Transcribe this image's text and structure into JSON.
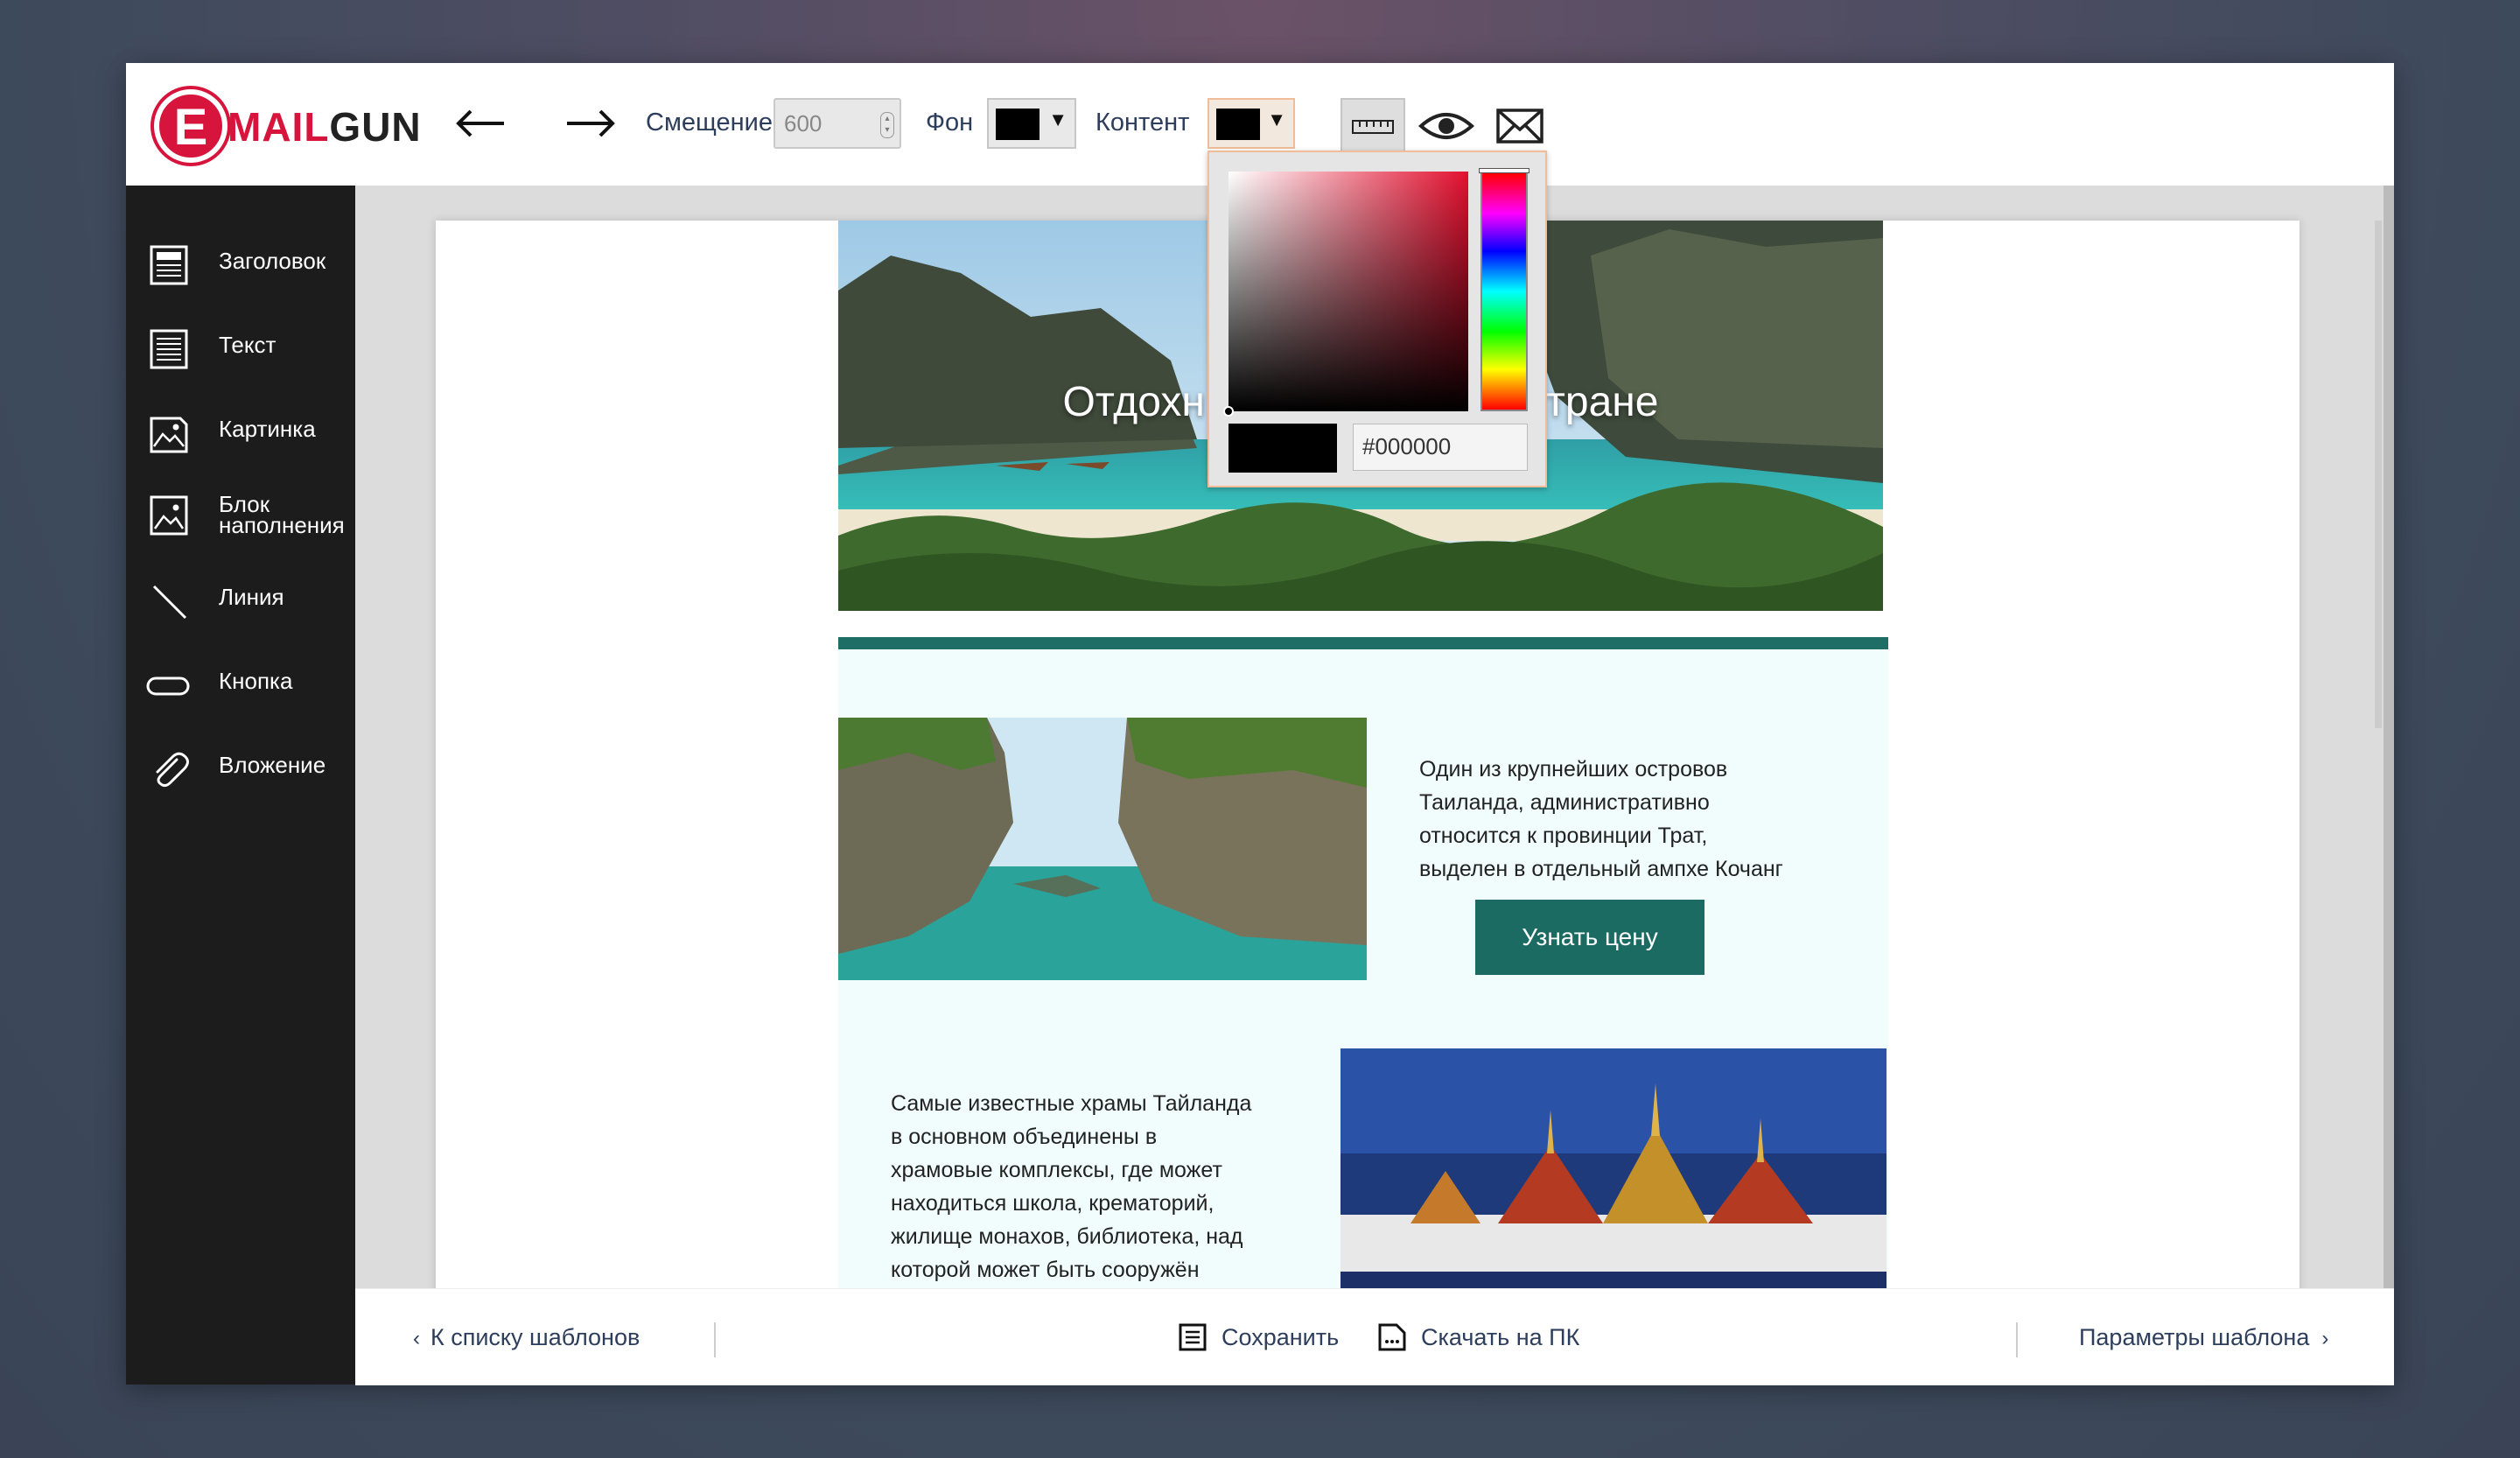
{
  "app": {
    "logo_letter": "E",
    "logo_mail": "MAIL",
    "logo_gun": "GUN"
  },
  "toolbar": {
    "offset_label": "Смещение",
    "offset_value": "600",
    "bg_label": "Фон",
    "content_label": "Контент",
    "bg_color": "#000000",
    "content_color": "#000000"
  },
  "sidebar": {
    "items": [
      {
        "label": "Заголовок",
        "icon": "heading-block-icon"
      },
      {
        "label": "Текст",
        "icon": "text-block-icon"
      },
      {
        "label": "Картинка",
        "icon": "image-block-icon"
      },
      {
        "label": "Блок\nнаполнения",
        "icon": "fill-block-icon"
      },
      {
        "label": "Линия",
        "icon": "line-icon"
      },
      {
        "label": "Кнопка",
        "icon": "button-icon"
      },
      {
        "label": "Вложение",
        "icon": "attachment-icon"
      }
    ]
  },
  "email": {
    "hero_title_left": "Отдохн",
    "hero_title_right": "тране",
    "block1_text": "Один из крупнейших островов\nТаиланда, административно\nотносится к провинции Трат,\nвыделен в отдельный ампхе Кочанг",
    "block1_button": "Узнать цену",
    "block2_text": "Самые известные храмы Тайланда\nв основном объединены в\nхрамовые комплексы, где может\nнаходиться школа, крематорий,\nжилище монахов, библиотека, над\nкоторой может быть сооружён"
  },
  "colorpicker": {
    "hex": "#000000",
    "hue_color": "#e3102f"
  },
  "bottombar": {
    "back": "К списку шаблонов",
    "save": "Сохранить",
    "download": "Скачать на ПК",
    "params": "Параметры шаблона"
  },
  "colors": {
    "accent": "#d7143c",
    "teal": "#1b6b63",
    "sidebar_bg": "#1c1c1c",
    "label": "#2d3e5c"
  }
}
